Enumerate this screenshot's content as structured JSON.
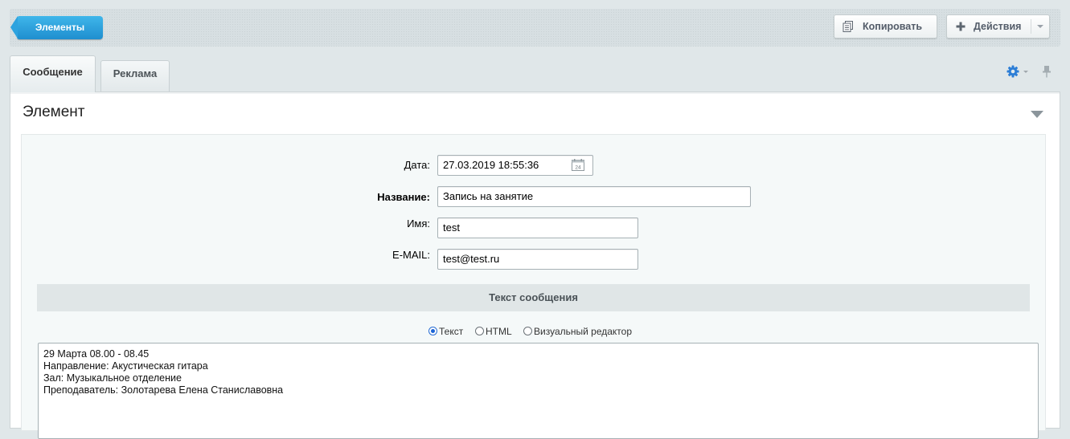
{
  "toolbar": {
    "back_label": "Элементы",
    "copy_label": "Копировать",
    "actions_label": "Действия"
  },
  "tabs": [
    {
      "label": "Сообщение",
      "active": true
    },
    {
      "label": "Реклама",
      "active": false
    }
  ],
  "icons": {
    "copy": "copy-icon",
    "actions": "plus-icon",
    "settings": "gear-icon",
    "pin": "pin-icon",
    "calendar": "calendar-icon",
    "calendar_day": "24"
  },
  "section": {
    "title": "Элемент"
  },
  "form": {
    "date_label": "Дата:",
    "date_value": "27.03.2019 18:55:36",
    "name_label": "Название:",
    "name_value": "Запись на занятие",
    "person_label": "Имя:",
    "person_value": "test",
    "email_label": "E-MAIL:",
    "email_value": "test@test.ru"
  },
  "message": {
    "header": "Текст сообщения",
    "modes": [
      {
        "label": "Текст",
        "selected": true
      },
      {
        "label": "HTML",
        "selected": false
      },
      {
        "label": "Визуальный редактор",
        "selected": false
      }
    ],
    "lines": [
      "29 Марта 08.00 - 08.45",
      "Направление: Акустическая гитара",
      "Зал: Музыкальное отделение",
      "Преподаватель: Золотарева Елена Станиславовна"
    ]
  },
  "colors": {
    "accent": "#1f8ecf",
    "radio_selected": "#1a64d6",
    "settings_icon": "#2d7ed6"
  }
}
